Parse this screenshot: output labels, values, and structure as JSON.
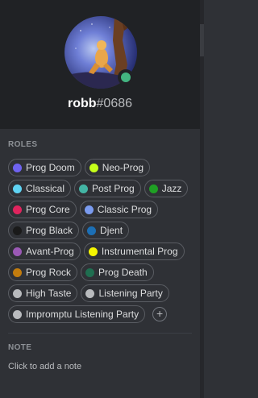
{
  "profile": {
    "username": "robb",
    "discriminator": "#0686",
    "status_color": "#43b581"
  },
  "roles_section": {
    "title": "ROLES",
    "roles": [
      {
        "name": "Prog Doom",
        "color": "#6f63f0"
      },
      {
        "name": "Neo-Prog",
        "color": "#c6ff1a"
      },
      {
        "name": "Classical",
        "color": "#5fd3f3"
      },
      {
        "name": "Post Prog",
        "color": "#43b5a5"
      },
      {
        "name": "Jazz",
        "color": "#1fa024"
      },
      {
        "name": "Prog Core",
        "color": "#e0245e"
      },
      {
        "name": "Classic Prog",
        "color": "#7a9bef"
      },
      {
        "name": "Prog Black",
        "color": "#1a1a1a"
      },
      {
        "name": "Djent",
        "color": "#1c6fb5"
      },
      {
        "name": "Avant-Prog",
        "color": "#9b59b6"
      },
      {
        "name": "Instrumental Prog",
        "color": "#f5f500"
      },
      {
        "name": "Prog Rock",
        "color": "#c27c0e"
      },
      {
        "name": "Prog Death",
        "color": "#1f6e50"
      },
      {
        "name": "High Taste",
        "color": "#b9bbbe"
      },
      {
        "name": "Listening Party",
        "color": "#b9bbbe"
      },
      {
        "name": "Impromptu Listening Party",
        "color": "#b9bbbe"
      }
    ],
    "add_role_icon": "plus-icon",
    "add_role_glyph": "+"
  },
  "note_section": {
    "title": "NOTE",
    "placeholder": "Click to add a note"
  }
}
